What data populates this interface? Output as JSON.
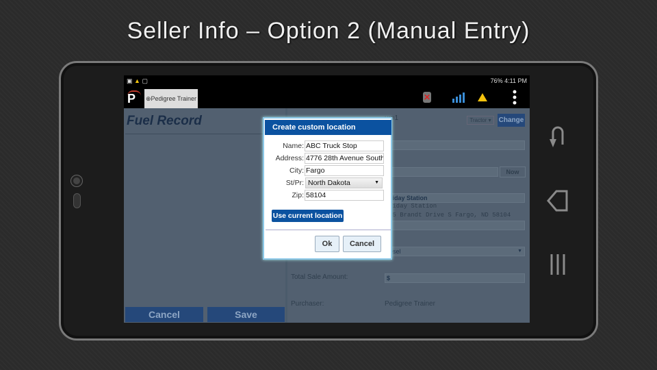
{
  "slide": {
    "title": "Seller Info – Option 2 (Manual Entry)"
  },
  "statusbar": {
    "right": "76%  4:11 PM"
  },
  "appbar": {
    "tab_label": "⊕Pedigree Trainer",
    "icons": [
      "app-logo",
      "no-device-icon",
      "signal-bars-icon",
      "warning-icon",
      "more-vert-icon"
    ]
  },
  "left": {
    "title": "Fuel Record",
    "cancel": "Cancel",
    "save": "Save"
  },
  "right": {
    "unit_value_fragment": "urn1",
    "unit_type": "Tractor ▾",
    "change": "Change",
    "now": "Now",
    "station_fragment": "liday Station",
    "station_line1_fragment": "liday Station",
    "station_line2_fragment": "55 Brandt Drive S Fargo, ND 58104",
    "fuel_type_fragment": "esel",
    "total_label": "Total Sale Amount:",
    "total_prefix": "$",
    "purchaser_label": "Purchaser:",
    "purchaser_value": "Pedigree Trainer"
  },
  "dialog": {
    "title": "Create custom location",
    "name_label": "Name:",
    "name": "ABC Truck Stop",
    "address_label": "Address:",
    "address": "4776 28th Avenue South",
    "city_label": "City:",
    "city": "Fargo",
    "state_label": "St/Pr:",
    "state": "North Dakota",
    "zip_label": "Zip:",
    "zip": "58104",
    "use_current": "Use current location",
    "ok": "Ok",
    "cancel": "Cancel"
  },
  "colors": {
    "dialog_header": "#0b52a0",
    "app_button": "#25487a"
  }
}
